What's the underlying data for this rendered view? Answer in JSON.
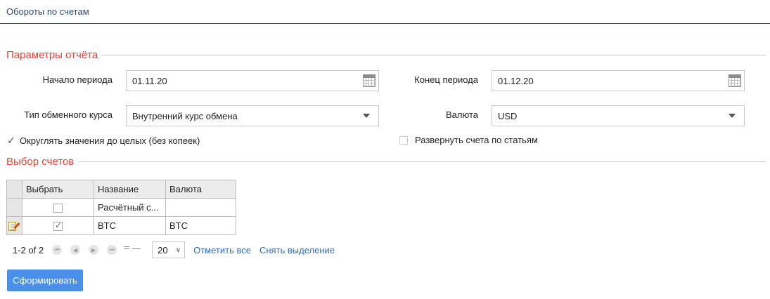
{
  "header": {
    "title": "Обороты по счетам"
  },
  "report_params": {
    "legend": "Параметры отчёта",
    "start": {
      "label": "Начало периода",
      "value": "01.11.20"
    },
    "end": {
      "label": "Конец периода",
      "value": "01.12.20"
    },
    "rate_type": {
      "label": "Тип обменного курса",
      "value": "Внутренний курс обмена"
    },
    "currency": {
      "label": "Валюта",
      "value": "USD"
    },
    "round": {
      "label": "Округлять значения до целых (без копеек)",
      "checked": true
    },
    "expand": {
      "label": "Развернуть счета по статьям",
      "checked": false
    }
  },
  "accounts": {
    "legend": "Выбор счетов",
    "columns": [
      "Выбрать",
      "Название",
      "Валюта"
    ],
    "rows": [
      {
        "checked": false,
        "name": "Расчётный с...",
        "currency": ""
      },
      {
        "checked": true,
        "name": "BTC",
        "currency": "BTC"
      }
    ]
  },
  "pager": {
    "range": "1-2 of 2",
    "page_size": "20",
    "select_all": "Отметить все",
    "deselect": "Снять выделение"
  },
  "submit_label": "Сформировать"
}
